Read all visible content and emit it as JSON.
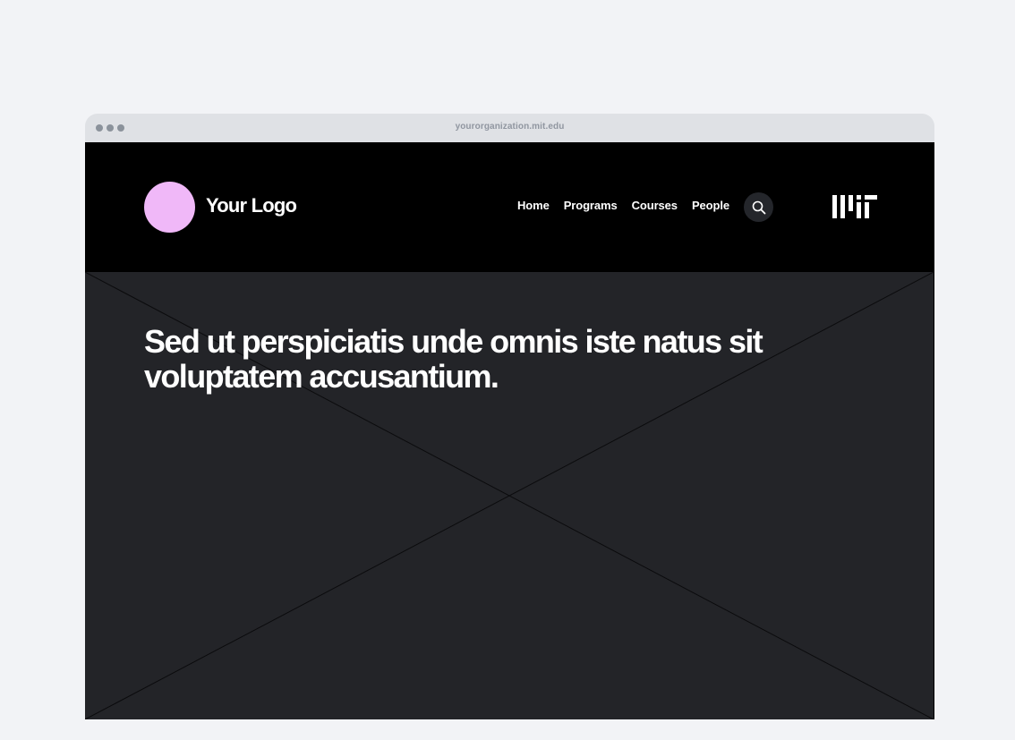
{
  "browser": {
    "url": "yourorganization.mit.edu",
    "window_controls": [
      "dot",
      "dot",
      "dot"
    ]
  },
  "header": {
    "logo_text": "Your Logo",
    "logo_color": "#f0b8f8",
    "nav": [
      {
        "label": "Home"
      },
      {
        "label": "Programs"
      },
      {
        "label": "Courses"
      },
      {
        "label": "People"
      }
    ],
    "search_icon": "search-icon",
    "brand_logo": "mit-logo"
  },
  "hero": {
    "headline": "Sed ut perspiciatis unde omnis iste natus sit voluptatem accusantium.",
    "image": "image-placeholder"
  }
}
